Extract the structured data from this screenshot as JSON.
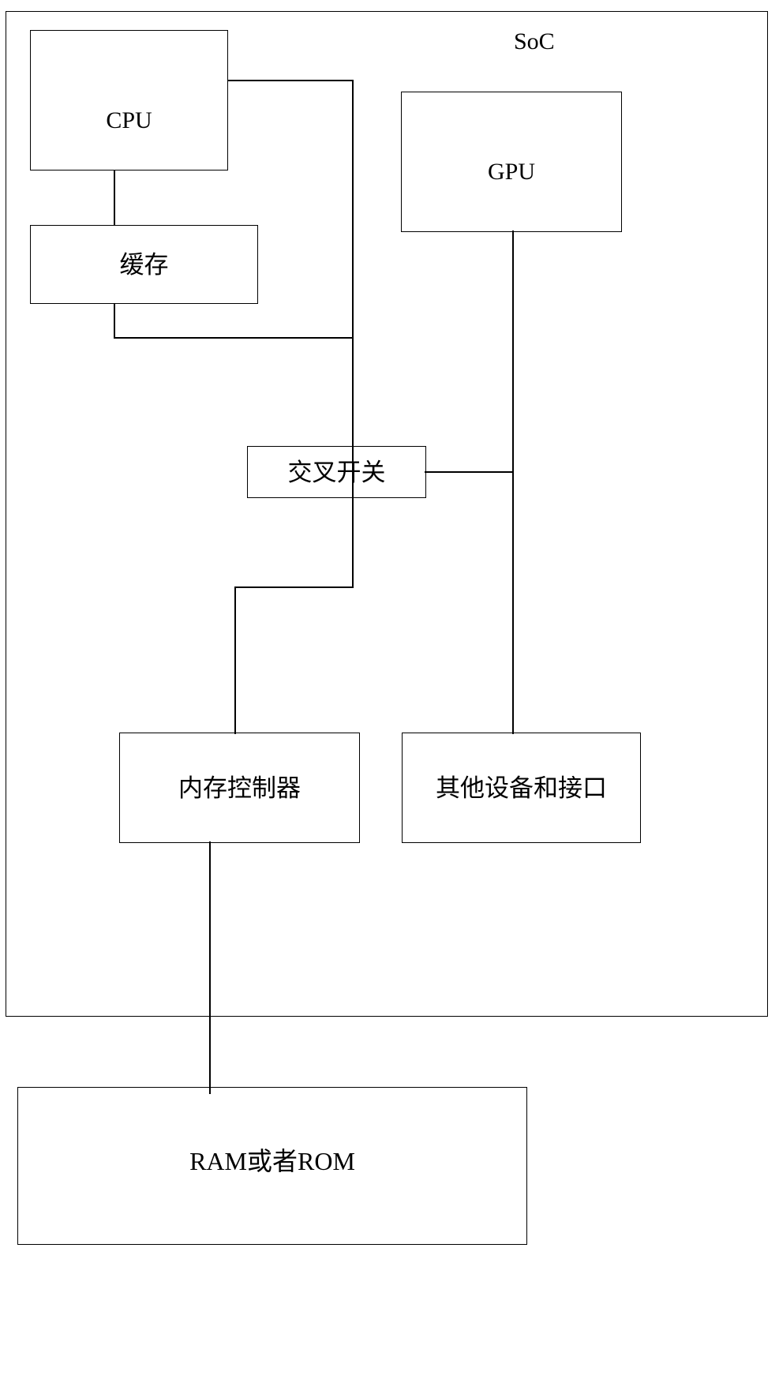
{
  "diagram": {
    "title": "SoC",
    "frame_label": "SoC",
    "line_color": "#000000",
    "background_color": "#ffffff",
    "blocks": [
      {
        "id": "cpu",
        "label": "CPU"
      },
      {
        "id": "cache",
        "label": "缓存"
      },
      {
        "id": "gpu",
        "label": "GPU"
      },
      {
        "id": "crossbar",
        "label": "交叉开关"
      },
      {
        "id": "memctl",
        "label": "内存控制器"
      },
      {
        "id": "otherdev",
        "label": "其他设备和接口"
      },
      {
        "id": "ram",
        "label": "RAM或者ROM"
      }
    ],
    "connections": [
      {
        "from": "cpu",
        "to": "crossbar"
      },
      {
        "from": "cpu",
        "to": "cache"
      },
      {
        "from": "cache",
        "to": "crossbar"
      },
      {
        "from": "crossbar",
        "to": "memctl"
      },
      {
        "from": "crossbar",
        "to": "gpu"
      },
      {
        "from": "gpu",
        "to": "otherdev"
      },
      {
        "from": "memctl",
        "to": "ram"
      }
    ]
  }
}
